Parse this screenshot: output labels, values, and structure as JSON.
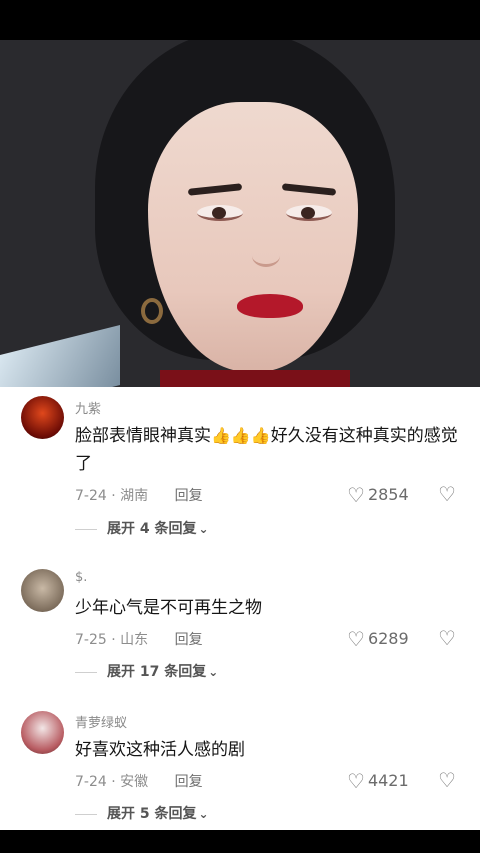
{
  "comments": [
    {
      "username": "九紫",
      "text_before": "脸部表情眼神真实",
      "text_after": "好久没有这种真实的感觉了",
      "date": "7-24",
      "location": "湖南",
      "reply_label": "回复",
      "likes": "2854",
      "expand_label": "展开 4 条回复"
    },
    {
      "username": "$.",
      "text": "少年心气是不可再生之物",
      "date": "7-25",
      "location": "山东",
      "reply_label": "回复",
      "likes": "6289",
      "expand_label": "展开 17 条回复"
    },
    {
      "username": "青萝绿蚁",
      "text": "好喜欢这种活人感的剧",
      "date": "7-24",
      "location": "安徽",
      "reply_label": "回复",
      "likes": "4421",
      "expand_label": "展开 5 条回复"
    }
  ],
  "icons": {
    "like": "heart-outline-icon",
    "dislike": "broken-heart-icon",
    "emoji": "thumbs-up-emoji"
  }
}
